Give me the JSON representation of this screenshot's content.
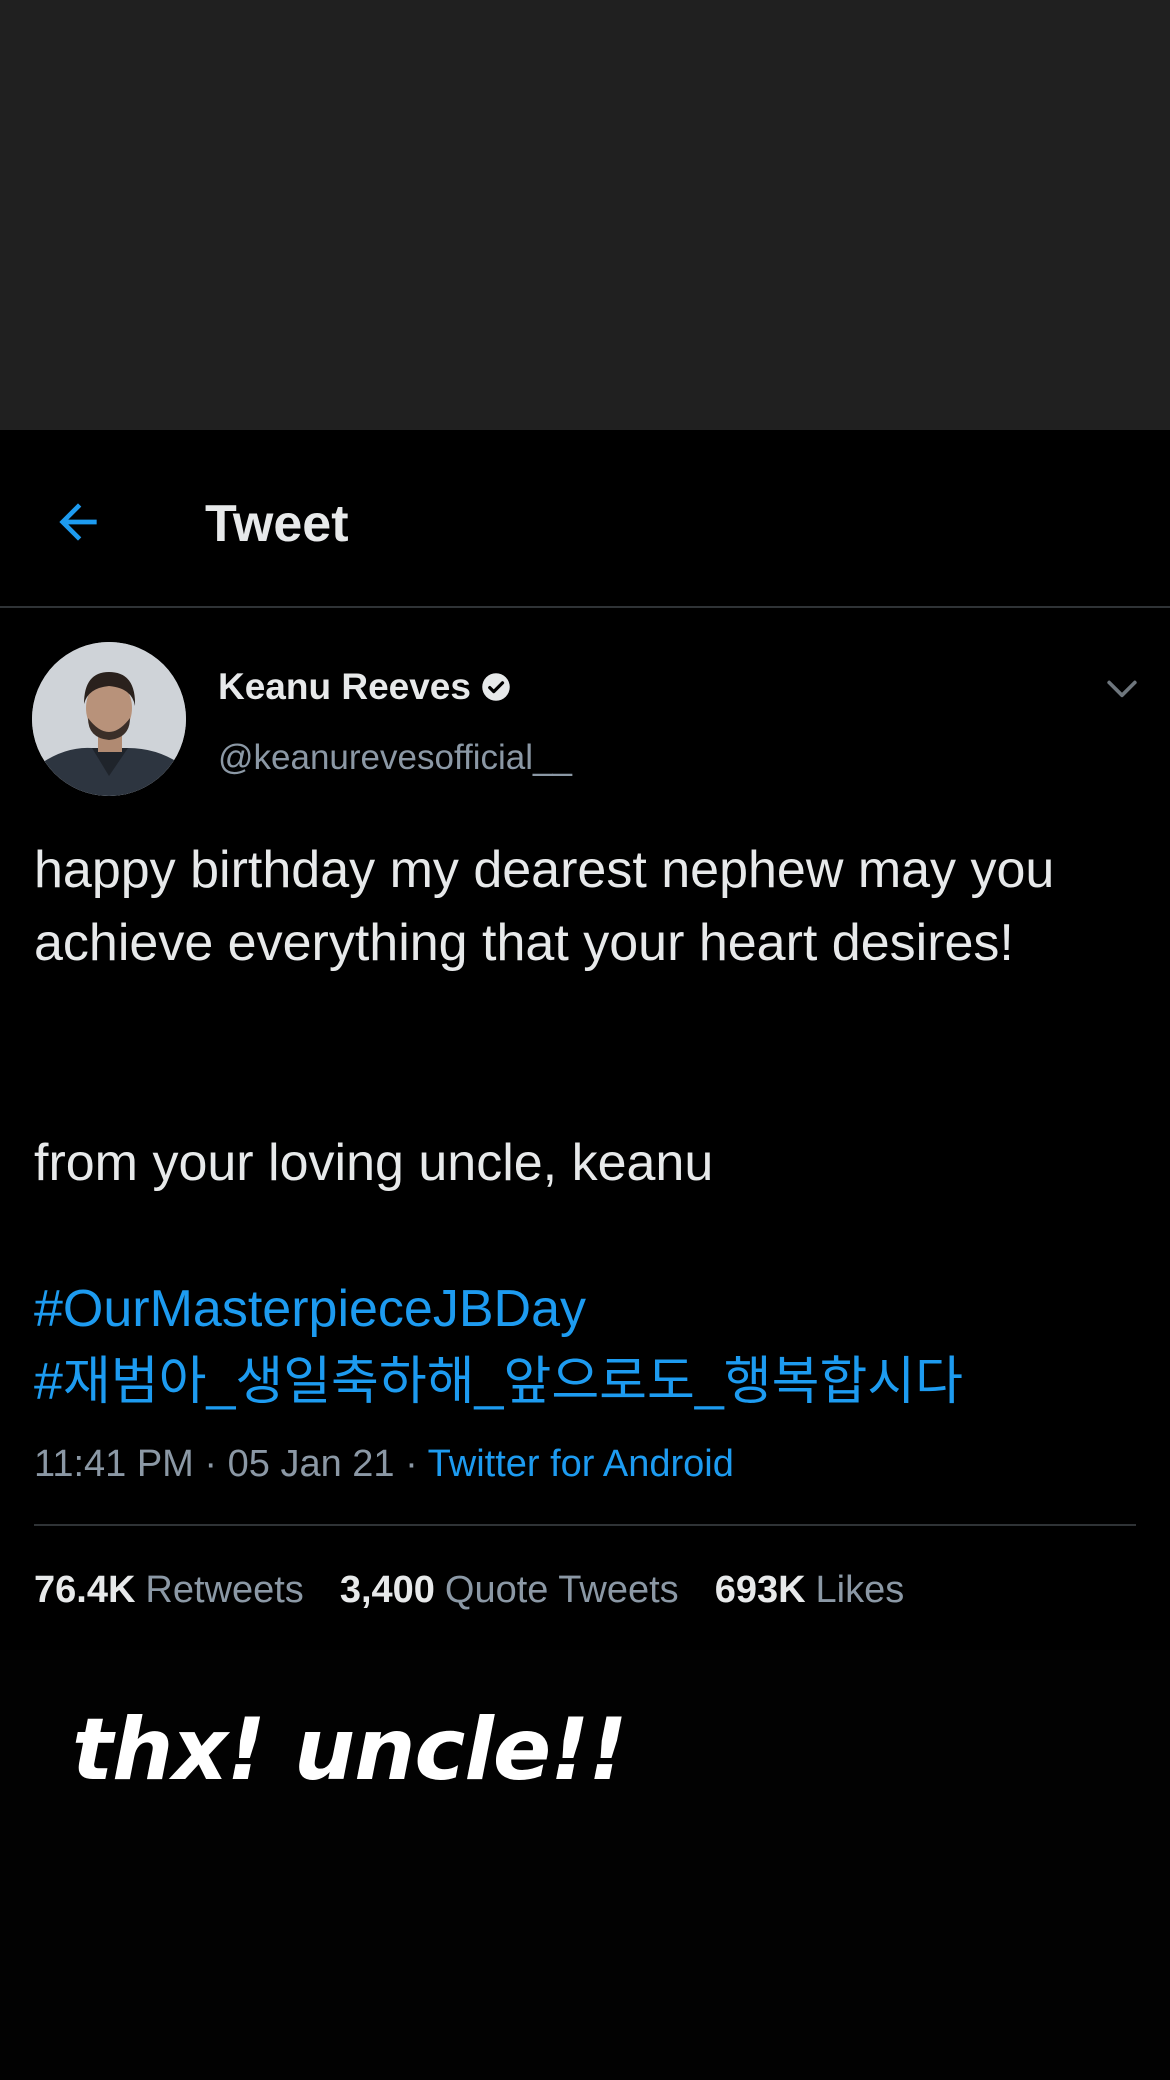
{
  "header": {
    "title": "Tweet",
    "back_icon": "arrow-left-icon"
  },
  "author": {
    "name": "Keanu Reeves",
    "handle": "@keanurevesofficial__",
    "verified": true,
    "avatar_icon": "avatar"
  },
  "tweet": {
    "text": "happy birthday my dearest nephew may you achieve everything that your heart desires!",
    "signoff": "from your loving uncle, keanu",
    "hashtags": [
      "#OurMasterpieceJBDay",
      "#재범아_생일축하해_앞으로도_행복합시다"
    ],
    "time": "11:41 PM",
    "date": "05 Jan 21",
    "separator": "·",
    "source": "Twitter for Android"
  },
  "stats": {
    "retweets_count": "76.4K",
    "retweets_label": "Retweets",
    "quotes_count": "3,400",
    "quotes_label": "Quote Tweets",
    "likes_count": "693K",
    "likes_label": "Likes"
  },
  "caption": "thx! uncle!!",
  "colors": {
    "accent": "#1d9bf0",
    "text_primary": "#e7e9ea",
    "text_secondary": "#8b98a5",
    "background": "#000000",
    "story_top": "#202020",
    "divider": "#2f3336"
  }
}
